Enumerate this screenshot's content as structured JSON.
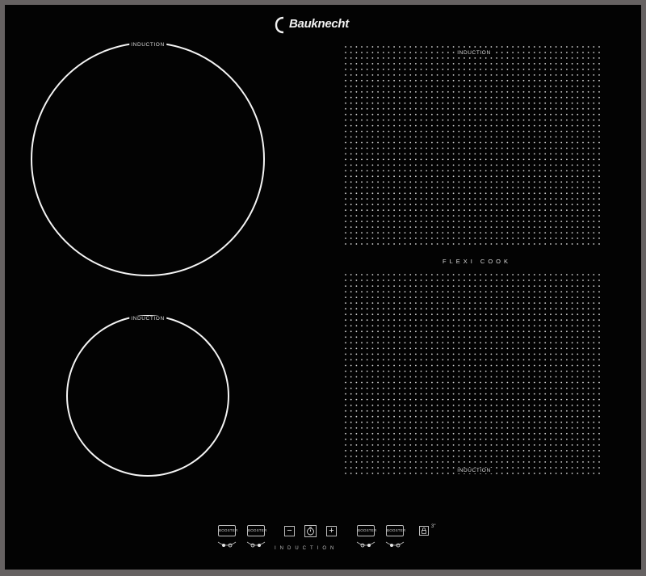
{
  "brand": {
    "name": "Bauknecht"
  },
  "zones": {
    "large": {
      "label": "INDUCTION"
    },
    "small": {
      "label": "INDUCTION"
    },
    "flexi_top": {
      "label": "INDUCTION"
    },
    "flexi_bottom": {
      "label": "INDUCTION"
    },
    "flexi_band": {
      "label": "FLEXI COOK"
    }
  },
  "controls": {
    "booster_1": "BOOSTER",
    "booster_2": "BOOSTER",
    "booster_3": "BOOSTER",
    "booster_4": "BOOSTER",
    "minus": "−",
    "plus": "+",
    "strip_label": "INDUCTION",
    "lock_superscript": "3\""
  },
  "colors": {
    "glass": "#030303",
    "frame": "#666262",
    "lines": "#f4f4f4"
  }
}
